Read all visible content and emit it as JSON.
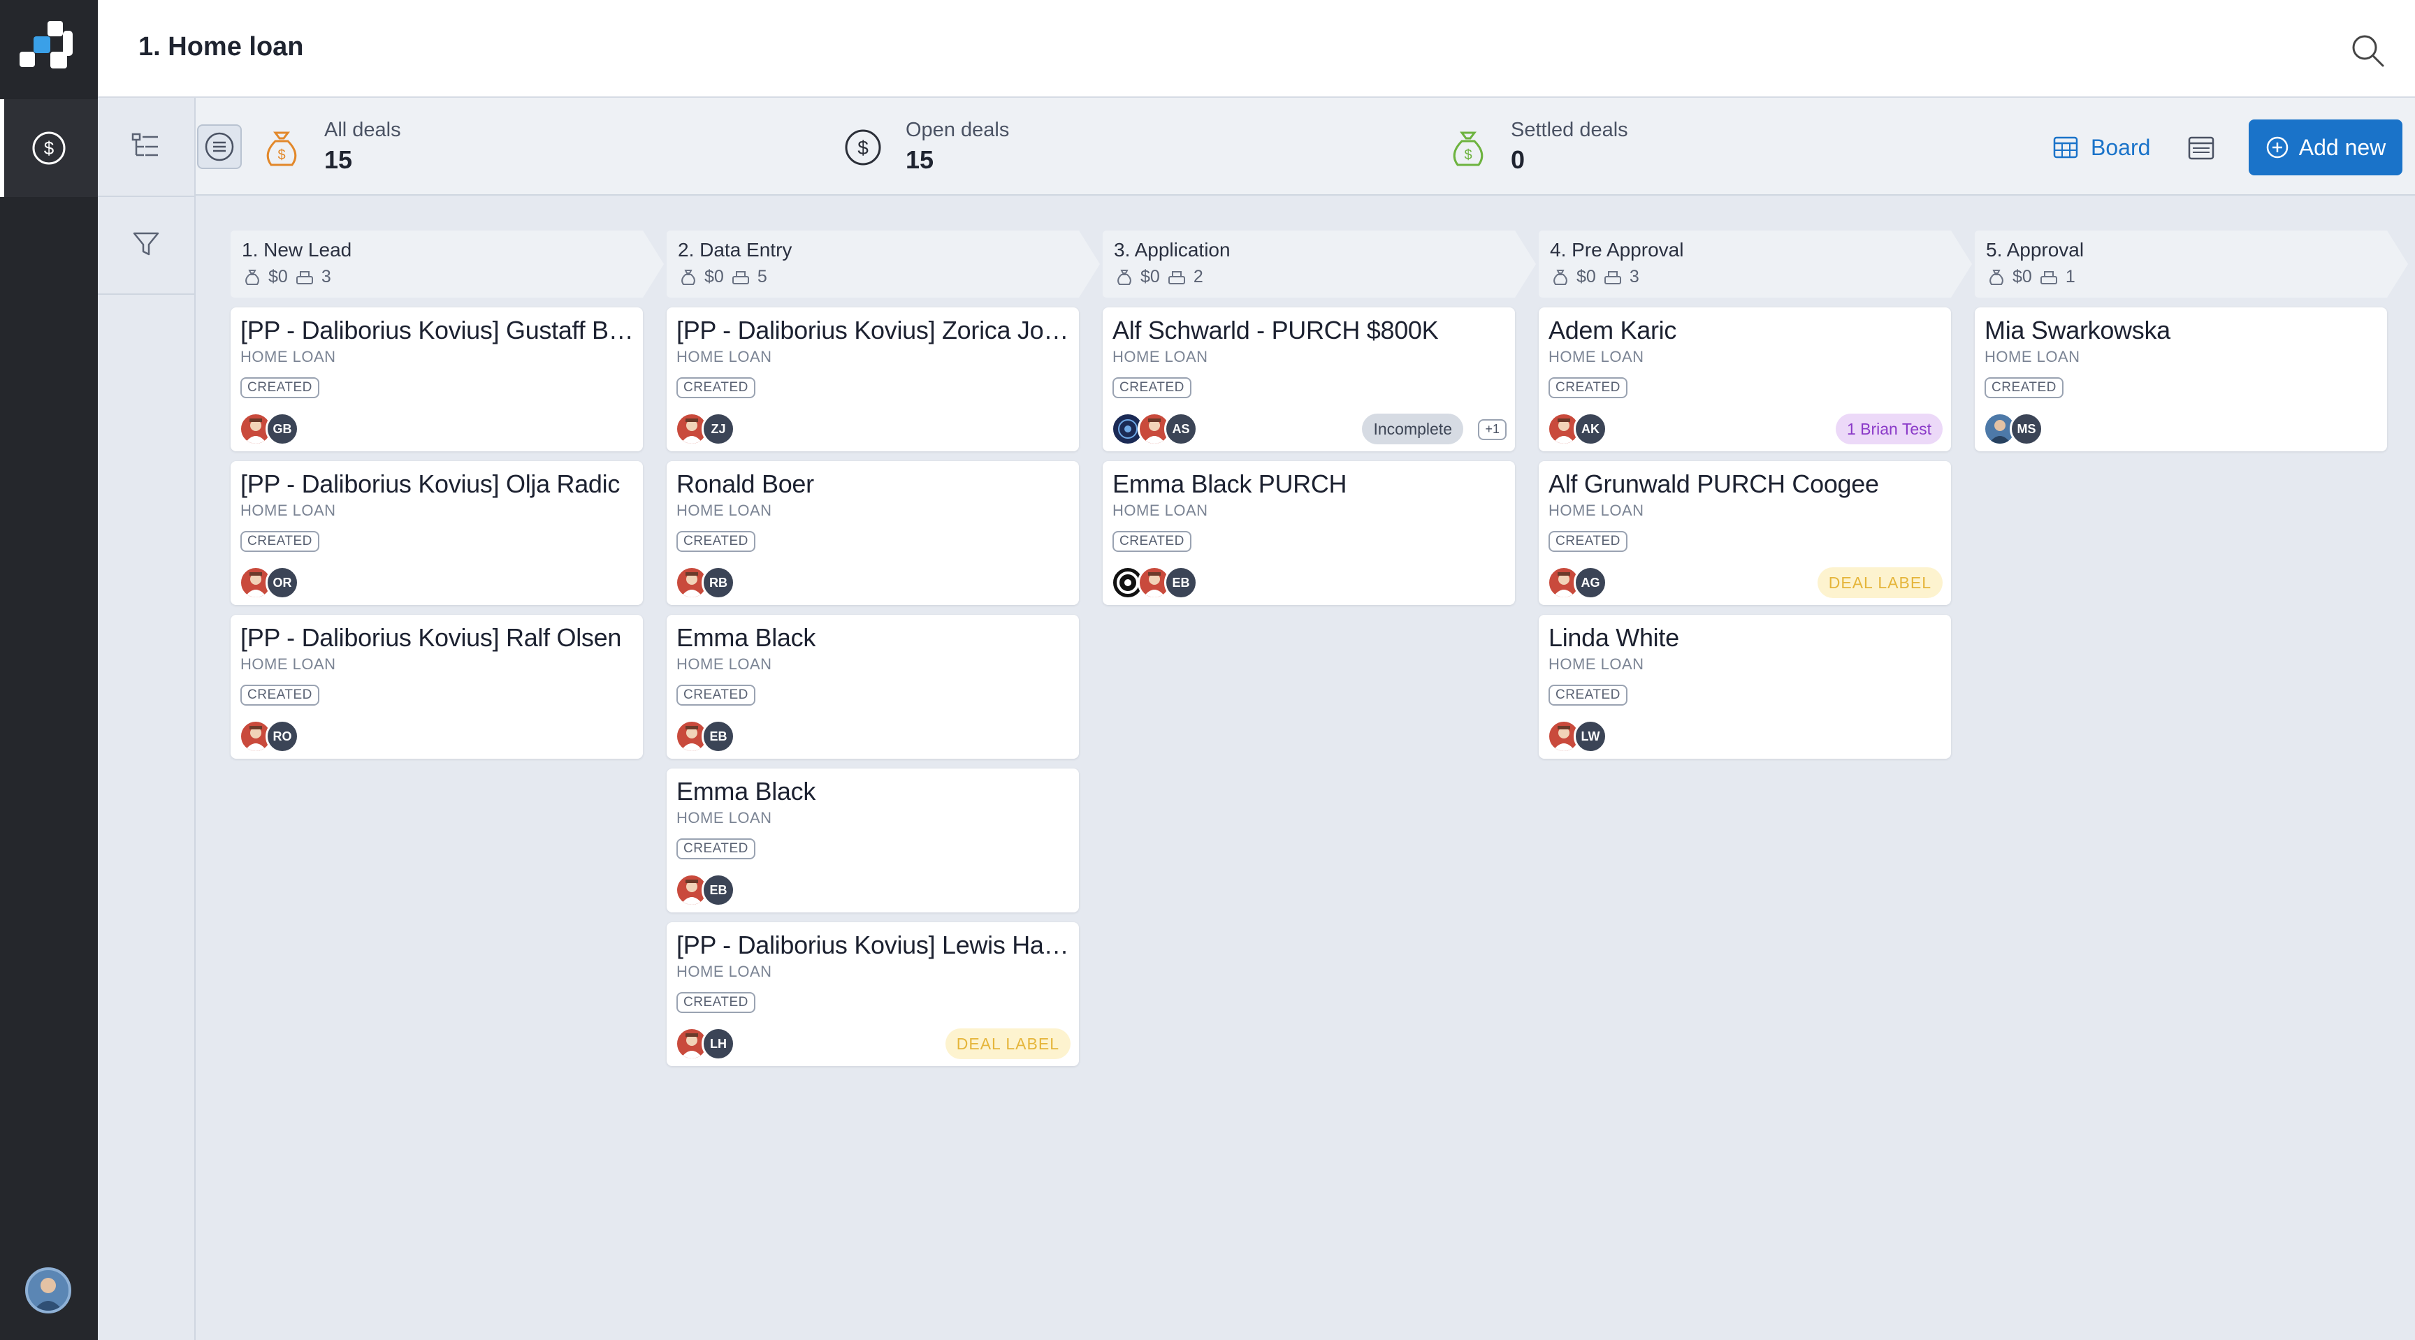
{
  "app": {
    "page_title": "1. Home loan",
    "brand_color": "#1a73c9"
  },
  "stats": {
    "all": {
      "label": "All deals",
      "value": "15",
      "icon": "money-bag-icon",
      "color": "#e2882a"
    },
    "open": {
      "label": "Open deals",
      "value": "15",
      "icon": "dollar-circle-icon",
      "color": "#2b2f38"
    },
    "settled": {
      "label": "Settled deals",
      "value": "0",
      "icon": "money-bag-icon",
      "color": "#6db33f"
    }
  },
  "view": {
    "board_label": "Board",
    "add_new_label": "Add new"
  },
  "columns": [
    {
      "title": "1. New Lead",
      "amount": "$0",
      "count": "3",
      "cards": [
        {
          "title": "[PP - Daliborius Kovius] Gustaff Blo...",
          "type": "HOME LOAN",
          "status": "CREATED",
          "initials": "GB"
        },
        {
          "title": "[PP - Daliborius Kovius] Olja Radic",
          "type": "HOME LOAN",
          "status": "CREATED",
          "initials": "OR"
        },
        {
          "title": "[PP - Daliborius Kovius] Ralf Olsen",
          "type": "HOME LOAN",
          "status": "CREATED",
          "initials": "RO"
        }
      ]
    },
    {
      "title": "2. Data Entry",
      "amount": "$0",
      "count": "5",
      "cards": [
        {
          "title": "[PP - Daliborius Kovius] Zorica Jones",
          "type": "HOME LOAN",
          "status": "CREATED",
          "initials": "ZJ"
        },
        {
          "title": "Ronald Boer",
          "type": "HOME LOAN",
          "status": "CREATED",
          "initials": "RB"
        },
        {
          "title": "Emma Black",
          "type": "HOME LOAN",
          "status": "CREATED",
          "initials": "EB"
        },
        {
          "title": "Emma Black",
          "type": "HOME LOAN",
          "status": "CREATED",
          "initials": "EB"
        },
        {
          "title": "[PP - Daliborius Kovius] Lewis Hami...",
          "type": "HOME LOAN",
          "status": "CREATED",
          "initials": "LH",
          "tag": "DEAL LABEL"
        }
      ]
    },
    {
      "title": "3. Application",
      "amount": "$0",
      "count": "2",
      "cards": [
        {
          "title": "Alf Schwarld - PURCH $800K",
          "type": "HOME LOAN",
          "status": "CREATED",
          "initials": "AS",
          "tag": "Incomplete",
          "extra": "+1"
        },
        {
          "title": "Emma Black PURCH",
          "type": "HOME LOAN",
          "status": "CREATED",
          "initials": "EB"
        }
      ]
    },
    {
      "title": "4. Pre Approval",
      "amount": "$0",
      "count": "3",
      "cards": [
        {
          "title": "Adem Karic",
          "type": "HOME LOAN",
          "status": "CREATED",
          "initials": "AK",
          "tag": "1 Brian Test"
        },
        {
          "title": "Alf Grunwald PURCH Coogee",
          "type": "HOME LOAN",
          "status": "CREATED",
          "initials": "AG",
          "tag": "DEAL LABEL"
        },
        {
          "title": "Linda White",
          "type": "HOME LOAN",
          "status": "CREATED",
          "initials": "LW"
        }
      ]
    },
    {
      "title": "5. Approval",
      "amount": "$0",
      "count": "1",
      "cards": [
        {
          "title": "Mia Swarkowska",
          "type": "HOME LOAN",
          "status": "CREATED",
          "initials": "MS"
        }
      ]
    }
  ]
}
